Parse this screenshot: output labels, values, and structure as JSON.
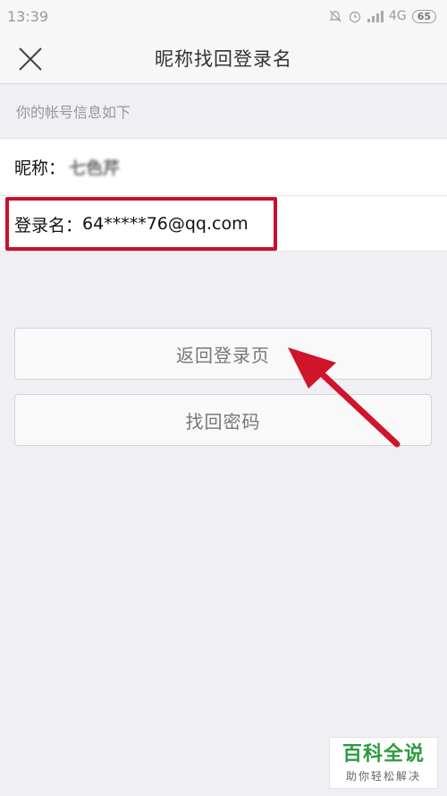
{
  "status_bar": {
    "time": "13:39",
    "network": "4G",
    "battery": "65"
  },
  "header": {
    "title": "昵称找回登录名",
    "close_icon": "close-icon"
  },
  "section_label": "你的帐号信息如下",
  "account": {
    "nickname_label": "昵称：",
    "nickname_value": "七色芹",
    "login_label": "登录名：",
    "login_value": "64*****76@qq.com"
  },
  "buttons": {
    "back_label": "返回登录页",
    "pwd_label": "找回密码"
  },
  "colors": {
    "highlight": "#c8102e",
    "arrow": "#d0142c",
    "watermark_green": "#2e9b3f"
  },
  "watermark": {
    "main": "百科全说",
    "sub": "助你轻松解决"
  }
}
